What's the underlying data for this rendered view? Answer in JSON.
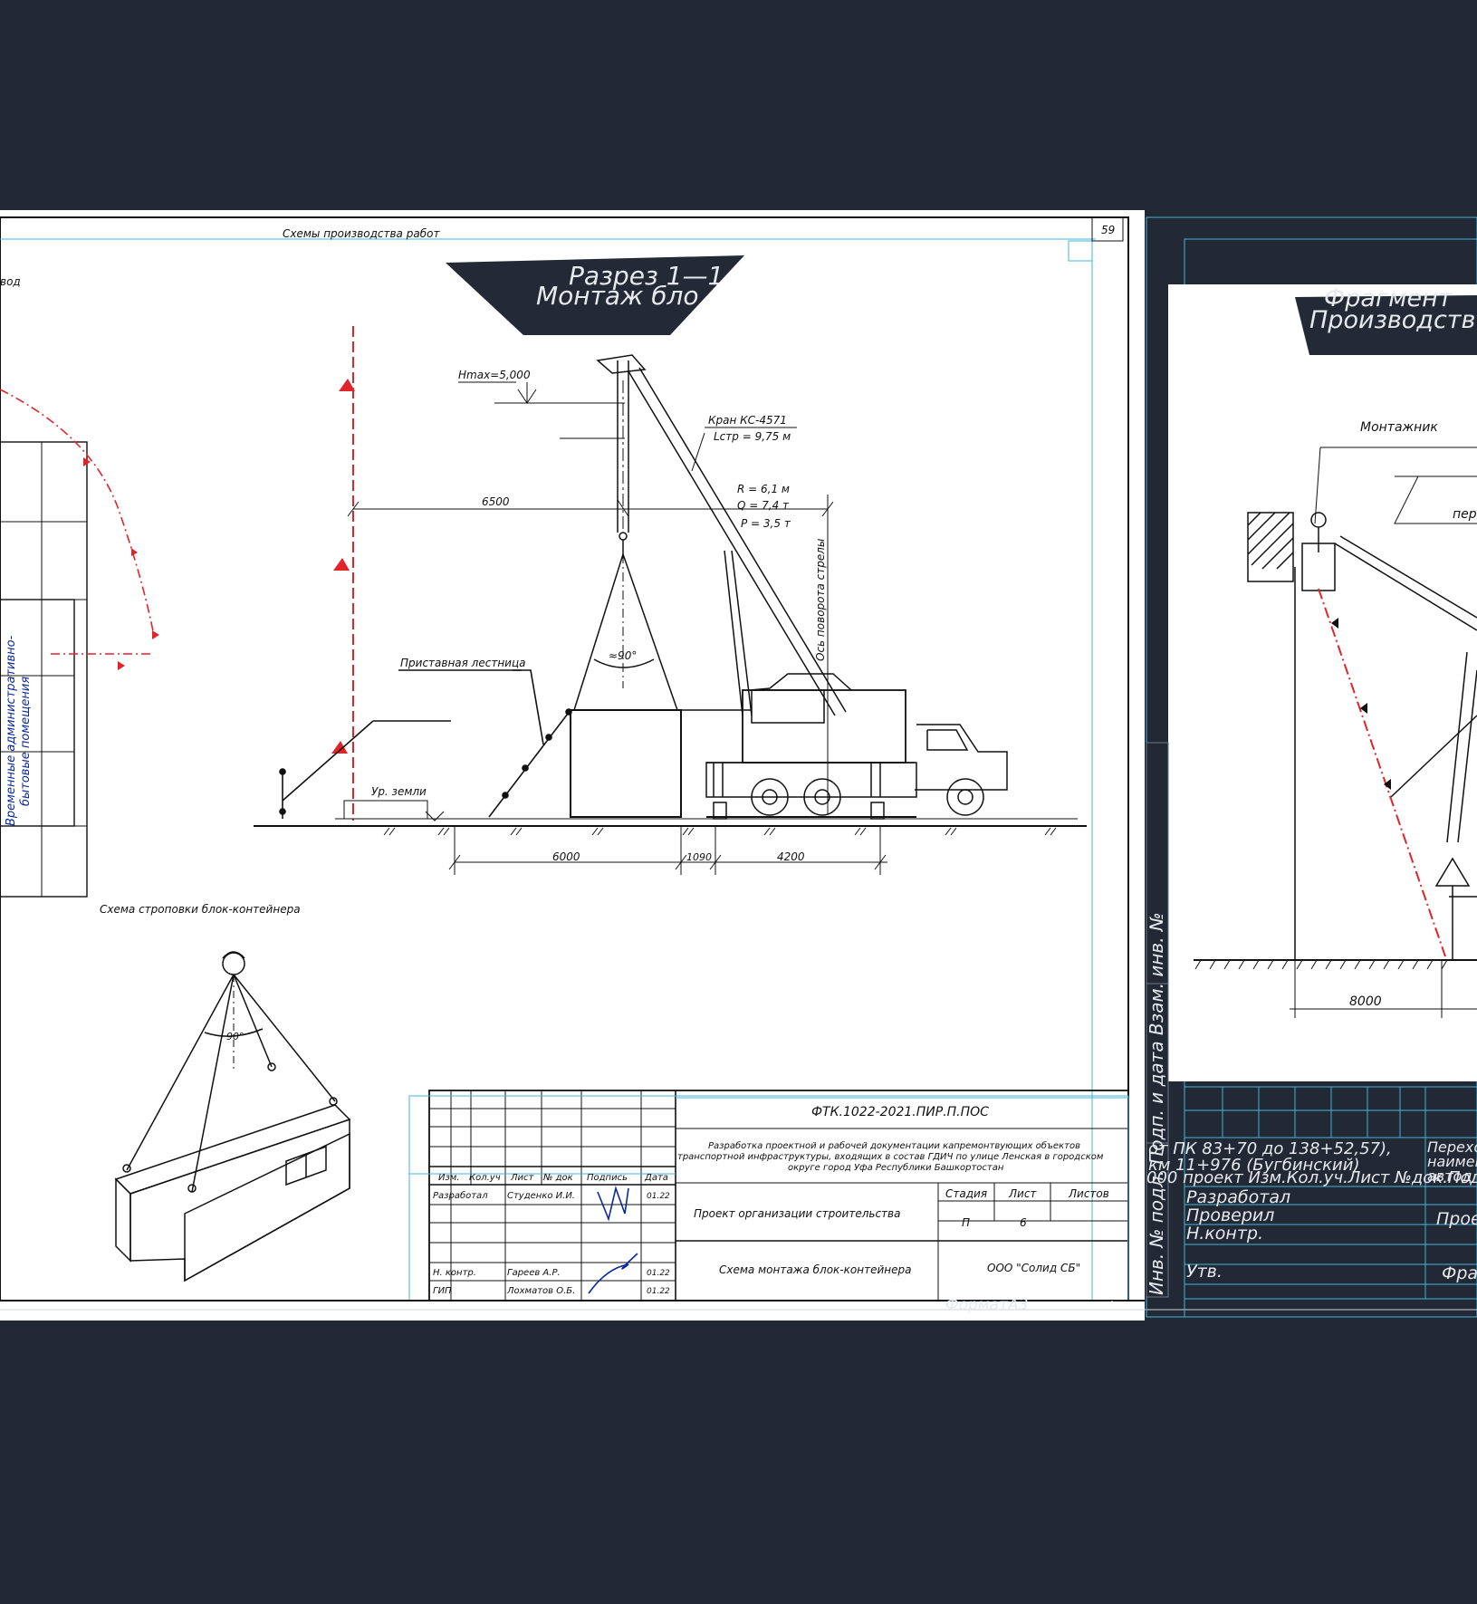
{
  "sheet1": {
    "header_title": "Схемы производства работ",
    "sheet_number": "59",
    "left_fragment_label": "вод",
    "section_title_line1": "Разрез 1—1",
    "section_title_line2": "Монтаж бло",
    "hmax_label": "Hmax=5,000",
    "crane_name": "Кран КС-4571",
    "crane_lstr": "Lстр = 9,75 м",
    "crane_r": "R = 6,1 м",
    "crane_q": "Q = 7,4 т",
    "crane_p": "P = 3,5 т",
    "dim_6500": "6500",
    "angle_label": "≈90°",
    "boom_axis_label": "Ось поворота стрелы",
    "ladder_label": "Приставная лестница",
    "ground_label": "Ур. земли",
    "dim_6000": "6000",
    "dim_1090": "1090",
    "dim_4200": "4200",
    "vertical_label_1": "Временные административно-",
    "vertical_label_2": "бытовые помещения",
    "slinging_title": "Схема строповки блок-контейнера",
    "sling_angle": "90°",
    "format_label": "ФорматА3"
  },
  "title_block": {
    "code": "ФТК.1022-2021.ПИР.П.ПОС",
    "description_line1": "Разработка проектной и рабочей документации капремонтвующих объектов",
    "description_line2": "транспортной инфраструктуры, входящих в состав ГДИЧ по улице Ленская в городском",
    "description_line3": "округе город Уфа Республики Башкортостан",
    "col_izm": "Изм.",
    "col_koluch": "Кол.уч",
    "col_list": "Лист",
    "col_ndok": "№ док",
    "col_podpis": "Подпись",
    "col_data": "Дата",
    "role_developer": "Разработал",
    "name_developer": "Студенко И.И.",
    "date_developer": "01.22",
    "role_nkontr": "Н. контр.",
    "name_nkontr": "Гареев А.Р.",
    "date_nkontr": "01.22",
    "role_gip": "ГИП",
    "name_gip": "Лохматов О.Б.",
    "date_gip": "01.22",
    "project_name": "Проект организации строительства",
    "stage_header": "Стадия",
    "sheet_header": "Лист",
    "sheets_header": "Листов",
    "stage_value": "П",
    "sheet_value": "6",
    "drawing_name": "Схема монтажа блок-контейнера",
    "company": "ООО \"Солид СБ\""
  },
  "sheet2": {
    "title_line1": "Фрагмент",
    "title_line2": "Производств",
    "worker_label": "Монтажник",
    "right_label": "пере",
    "dim_8000": "8000",
    "side_stamp": "Инв. № подл.   Подп. и дата   Взам. инв. №",
    "tb_line1": "от ПК 83+70 до 138+52,57),",
    "tb_line2": "км 11+976 (Бугбинский)",
    "tb_line3": "000 проект Изм.Кол.уч.Лист №док.Подп.Дата",
    "role_developer": "Разработал",
    "role_checker": "Проверил",
    "role_nkontr": "Н.контр.",
    "role_approved": "Утв.",
    "right_col_1": "Перехо",
    "right_col_2": "наимен",
    "right_col_3": "автод",
    "right_col_4": "Прое",
    "right_col_5": "Фра"
  },
  "colors": {
    "background": "#222834",
    "paper": "#ffffff",
    "frame_cyan": "#43b6de",
    "ink": "#111111",
    "red_marker": "#e0242a",
    "title_banner": "#232a36",
    "signature_blue": "#0a2a9a"
  }
}
